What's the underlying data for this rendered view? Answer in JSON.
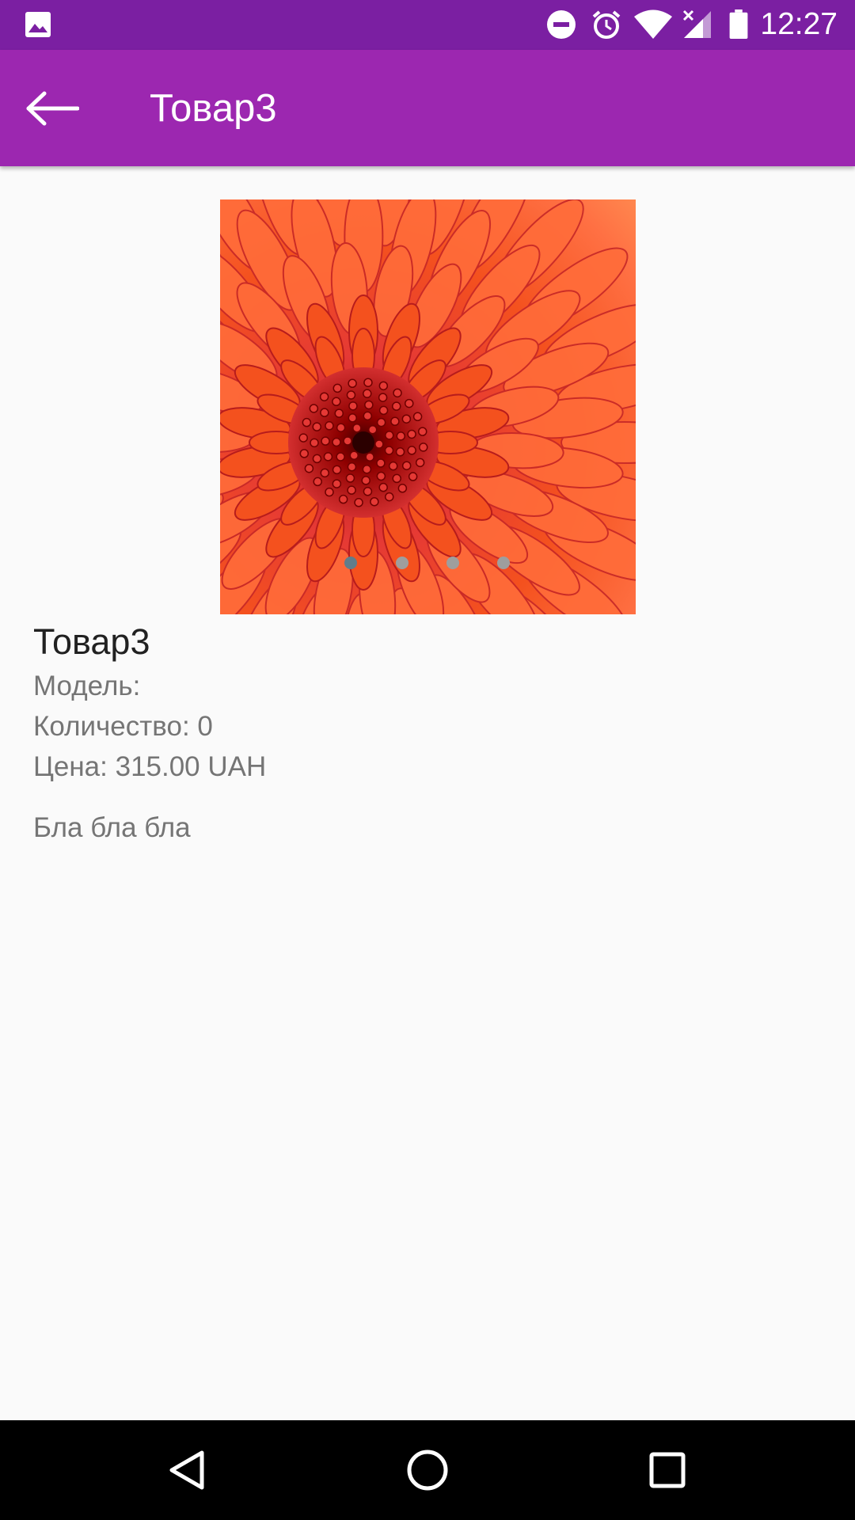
{
  "status_bar": {
    "time": "12:27",
    "icons": [
      "gallery-notification-icon",
      "do-not-disturb-icon",
      "alarm-icon",
      "wifi-icon",
      "cellular-signal-icon",
      "battery-icon"
    ]
  },
  "app_bar": {
    "title": "Товар3",
    "back_icon": "arrow-back-icon"
  },
  "carousel": {
    "image": "orange chrysanthemum photo",
    "page_count": 4,
    "active_index": 0
  },
  "product": {
    "name": "Товар3",
    "model": "Модель:",
    "quantity": "Количество: 0",
    "price": "Цена: 315.00 UAH",
    "description": "Бла бла бла"
  },
  "nav_bar": {
    "icons": [
      "back-triangle-icon",
      "home-circle-icon",
      "recents-square-icon"
    ]
  },
  "colors": {
    "status_bar": "#7b1fa2",
    "app_bar": "#9c27b0",
    "background": "#fafafa",
    "dot_active": "#607d8b",
    "dot_inactive": "#9e9e9e"
  }
}
